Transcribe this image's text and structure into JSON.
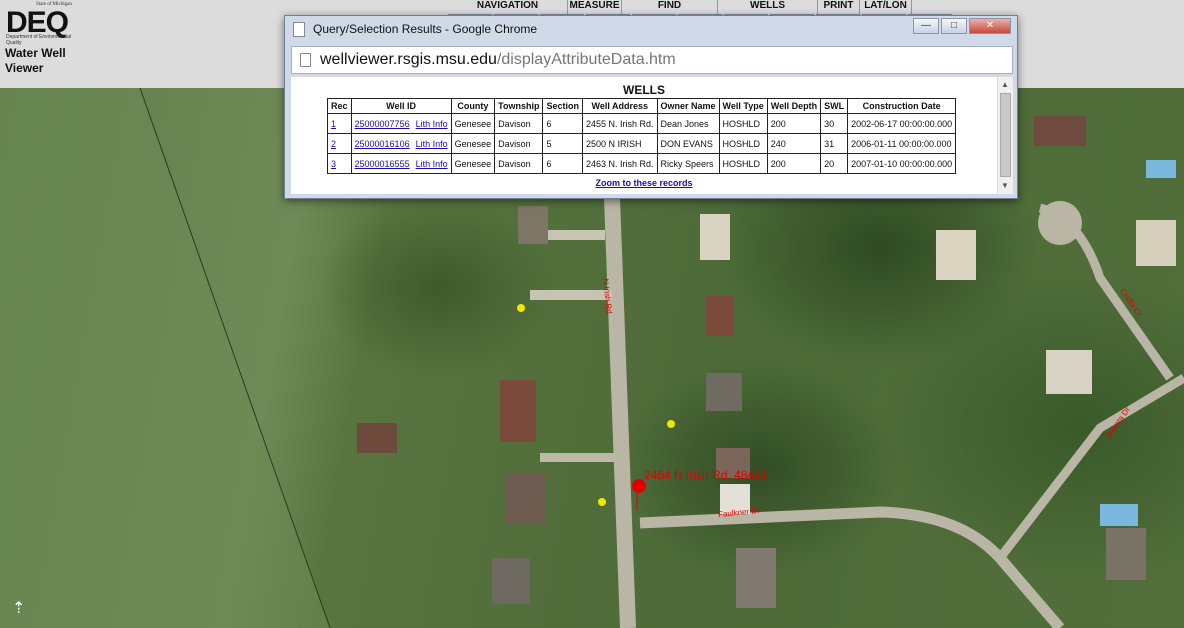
{
  "header": {
    "logo_text": "DEQ",
    "logo_state": "State of Michigan",
    "logo_dept": "Department of Environmental Quality",
    "app_title": "Water Well Viewer"
  },
  "menu": {
    "navigation": "NAVIGATION",
    "measure": "MEASURE",
    "find": "FIND",
    "wells": "WELLS",
    "print": "PRINT",
    "latlon": "LAT/LON"
  },
  "popup": {
    "title": "Query/Selection Results - Google Chrome",
    "url_host": "wellviewer.rsgis.msu.edu",
    "url_path": "/displayAttributeData.htm",
    "table_title": "WELLS",
    "zoom_link": "Zoom to these records",
    "lith_label": "Lith Info",
    "columns": [
      "Rec",
      "Well ID",
      "County",
      "Township",
      "Section",
      "Well Address",
      "Owner Name",
      "Well Type",
      "Well Depth",
      "SWL",
      "Construction Date"
    ],
    "rows": [
      {
        "rec": "1",
        "well_id": "25000007756",
        "county": "Genesee",
        "township": "Davison",
        "section": "6",
        "address": "2455 N. Irish Rd.",
        "owner": "Dean Jones",
        "type": "HOSHLD",
        "depth": "200",
        "swl": "30",
        "date": "2002-06-17 00:00:00.000"
      },
      {
        "rec": "2",
        "well_id": "25000016106",
        "county": "Genesee",
        "township": "Davison",
        "section": "5",
        "address": "2500 N IRISH",
        "owner": "DON EVANS",
        "type": "HOSHLD",
        "depth": "240",
        "swl": "31",
        "date": "2006-01-11 00:00:00.000"
      },
      {
        "rec": "3",
        "well_id": "25000016555",
        "county": "Genesee",
        "township": "Davison",
        "section": "6",
        "address": "2463 N. Irish Rd.",
        "owner": "Ricky Speers",
        "type": "HOSHLD",
        "depth": "200",
        "swl": "20",
        "date": "2007-01-10 00:00:00.000"
      }
    ]
  },
  "map": {
    "address_label": "2464 N Irish Rd, 48423",
    "streets": {
      "n_irish": "N Irish Rd",
      "faulkner": "Faulkner Dr",
      "crafts": "Crafts Ct",
      "dakota": "Dakota Dr"
    },
    "colors": {
      "well_marker": "#f2e600",
      "selected_marker": "#e00000"
    }
  }
}
